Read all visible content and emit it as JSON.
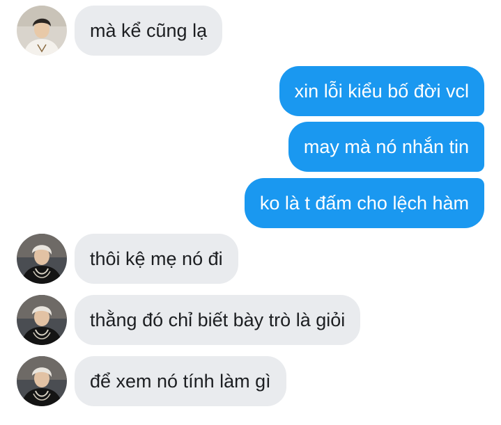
{
  "conversation": {
    "messages": [
      {
        "side": "incoming",
        "text": "mà kể cũng lạ",
        "avatar": "avatar-white-shirt"
      },
      {
        "side": "outgoing",
        "text": "xin lỗi kiểu bố đời vcl"
      },
      {
        "side": "outgoing",
        "text": "may mà nó nhắn tin"
      },
      {
        "side": "outgoing",
        "text": "ko là t đấm cho lệch hàm"
      },
      {
        "side": "incoming",
        "text": "thôi kệ mẹ nó đi",
        "avatar": "avatar-black-outfit"
      },
      {
        "side": "incoming",
        "text": "thằng đó chỉ biết bày trò là giỏi",
        "avatar": "avatar-black-outfit"
      },
      {
        "side": "incoming",
        "text": "để xem nó tính làm gì",
        "avatar": "avatar-black-outfit"
      }
    ]
  },
  "colors": {
    "incoming_bubble": "#e9ebee",
    "outgoing_bubble": "#1a98f0",
    "incoming_text": "#1c1e21",
    "outgoing_text": "#ffffff"
  }
}
